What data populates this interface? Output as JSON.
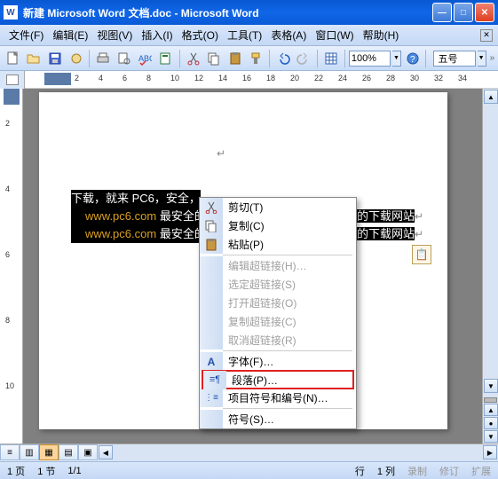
{
  "window": {
    "title": "新建 Microsoft Word 文档.doc - Microsoft Word"
  },
  "menubar": {
    "file": "文件(F)",
    "edit": "编辑(E)",
    "view": "视图(V)",
    "insert": "插入(I)",
    "format": "格式(O)",
    "tools": "工具(T)",
    "table": "表格(A)",
    "window": "窗口(W)",
    "help": "帮助(H)"
  },
  "toolbar": {
    "zoom": "100%",
    "fontsize": "五号"
  },
  "ruler": {
    "ticks": [
      "2",
      "4",
      "6",
      "8",
      "10",
      "12",
      "14",
      "16",
      "18",
      "20",
      "22",
      "24",
      "26",
      "28",
      "30",
      "32",
      "34"
    ]
  },
  "vruler": {
    "ticks": [
      "2",
      "4",
      "6",
      "8",
      "10"
    ]
  },
  "document": {
    "line1": "下载，就来 PC6，安全，",
    "line2_a": "www.pc6.com",
    "line2_b": " 最安全的下",
    "line2_right": "全的下载网站",
    "line3_a": "www.pc6.com",
    "line3_b": " 最安全的",
    "line3_right": "全的下载网站",
    "pmark": "↵"
  },
  "contextmenu": {
    "cut": "剪切(T)",
    "copy": "复制(C)",
    "paste": "粘贴(P)",
    "edit_hyperlink": "编辑超链接(H)…",
    "select_hyperlink": "选定超链接(S)",
    "open_hyperlink": "打开超链接(O)",
    "copy_hyperlink": "复制超链接(C)",
    "remove_hyperlink": "取消超链接(R)",
    "font": "字体(F)…",
    "paragraph": "段落(P)…",
    "bullets": "项目符号和编号(N)…",
    "symbol": "符号(S)…"
  },
  "statusbar": {
    "page": "1 页",
    "section": "1 节",
    "pages": "1/1",
    "line": "行",
    "col": "1 列",
    "rec": "录制",
    "rev": "修订",
    "ext": "扩展"
  }
}
